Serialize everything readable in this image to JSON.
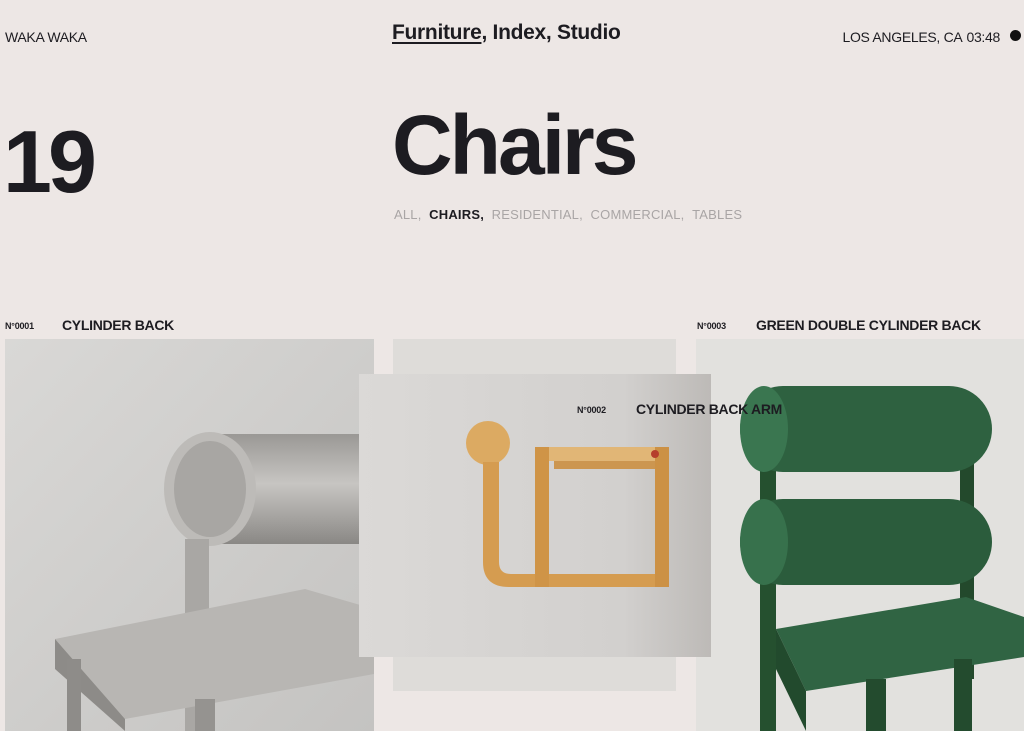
{
  "header": {
    "brand": "WAKA WAKA",
    "nav": [
      {
        "label": "Furniture",
        "active": true
      },
      {
        "label": "Index",
        "active": false
      },
      {
        "label": "Studio",
        "active": false
      }
    ],
    "separator": ", ",
    "location": "LOS ANGELES, CA",
    "time": "03:48"
  },
  "hero": {
    "count": "19",
    "title": "Chairs"
  },
  "filters": [
    {
      "label": "ALL",
      "active": false
    },
    {
      "label": "CHAIRS",
      "active": true
    },
    {
      "label": "RESIDENTIAL",
      "active": false
    },
    {
      "label": "COMMERCIAL",
      "active": false
    },
    {
      "label": "TABLES",
      "active": false
    }
  ],
  "products": [
    {
      "number": "N°0001",
      "name": "CYLINDER BACK",
      "image": "grey-plywood-chair"
    },
    {
      "number": "N°0002",
      "name": "CYLINDER BACK ARM",
      "image": "natural-wood-armchair"
    },
    {
      "number": "N°0003",
      "name": "GREEN DOUBLE CYLINDER BACK",
      "image": "green-double-cylinder-chair"
    }
  ],
  "colors": {
    "background": "#ede7e5",
    "text": "#1d1c21",
    "muted": "#a9a5a5",
    "green": "#2c5d3b",
    "wood": "#dcaa62"
  }
}
